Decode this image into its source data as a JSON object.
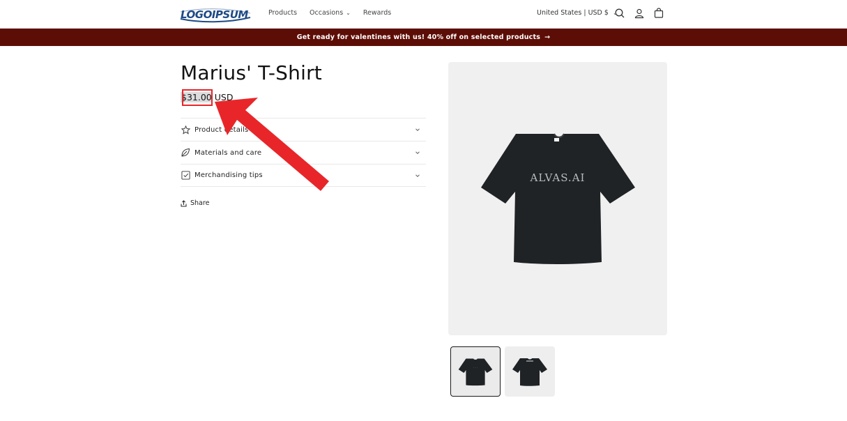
{
  "header": {
    "logo_text": "LOGOIPSUM",
    "nav": [
      {
        "label": "Products",
        "has_dropdown": false
      },
      {
        "label": "Occasions",
        "has_dropdown": true
      },
      {
        "label": "Rewards",
        "has_dropdown": false
      }
    ],
    "locale": "United States | USD $",
    "icons": [
      "search-icon",
      "account-icon",
      "cart-icon"
    ]
  },
  "announcement": {
    "text": "Get ready for valentines with us! 40% off on selected products",
    "arrow": "→",
    "background": "#5c0e06"
  },
  "product": {
    "title": "Marius' T-Shirt",
    "price_amount": "$31.00",
    "price_currency": "USD",
    "accordion": [
      {
        "label": "Product details",
        "icon": "star-icon"
      },
      {
        "label": "Materials and care",
        "icon": "leaf-icon"
      },
      {
        "label": "Merchandising tips",
        "icon": "checkbox-icon"
      }
    ],
    "share_label": "Share",
    "shirt_print": "ALVAS.AI"
  },
  "annotation": {
    "color": "#e8262a"
  }
}
